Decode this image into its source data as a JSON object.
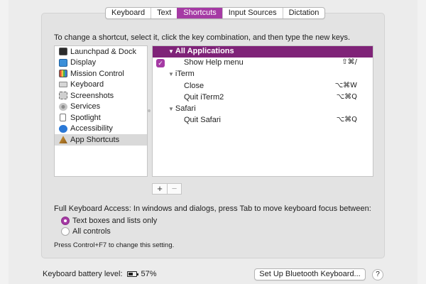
{
  "tabs": [
    {
      "label": "Keyboard",
      "active": false
    },
    {
      "label": "Text",
      "active": false
    },
    {
      "label": "Shortcuts",
      "active": true
    },
    {
      "label": "Input Sources",
      "active": false
    },
    {
      "label": "Dictation",
      "active": false
    }
  ],
  "instructions": "To change a shortcut, select it, click the key combination, and then type the new keys.",
  "categories": [
    {
      "label": "Launchpad & Dock",
      "icon": "launchpad-icon"
    },
    {
      "label": "Display",
      "icon": "display-icon"
    },
    {
      "label": "Mission Control",
      "icon": "mission-control-icon"
    },
    {
      "label": "Keyboard",
      "icon": "keyboard-icon"
    },
    {
      "label": "Screenshots",
      "icon": "screenshots-icon"
    },
    {
      "label": "Services",
      "icon": "gear-icon"
    },
    {
      "label": "Spotlight",
      "icon": "spotlight-icon"
    },
    {
      "label": "Accessibility",
      "icon": "accessibility-icon"
    },
    {
      "label": "App Shortcuts",
      "icon": "app-shortcuts-icon",
      "selected": true
    }
  ],
  "shortcuts": {
    "header": "All Applications",
    "rows": [
      {
        "label": "Show Help menu",
        "keys": "⇧⌘/",
        "checked": true
      },
      {
        "group": "iTerm"
      },
      {
        "label": "Close",
        "keys": "⌥⌘W"
      },
      {
        "label": "Quit iTerm2",
        "keys": "⌥⌘Q"
      },
      {
        "group": "Safari"
      },
      {
        "label": "Quit Safari",
        "keys": "⌥⌘Q"
      }
    ]
  },
  "buttons": {
    "add": "+",
    "remove": "−"
  },
  "full_keyboard_access": {
    "label": "Full Keyboard Access: In windows and dialogs, press Tab to move keyboard focus between:",
    "options": [
      {
        "label": "Text boxes and lists only",
        "selected": true
      },
      {
        "label": "All controls",
        "selected": false
      }
    ],
    "hint": "Press Control+F7 to change this setting."
  },
  "footer": {
    "battery_label": "Keyboard battery level:",
    "battery_value": "57%",
    "bluetooth_button": "Set Up Bluetooth Keyboard...",
    "help": "?"
  },
  "colors": {
    "accent": "#a53aa4",
    "header_row": "#7f2378"
  }
}
